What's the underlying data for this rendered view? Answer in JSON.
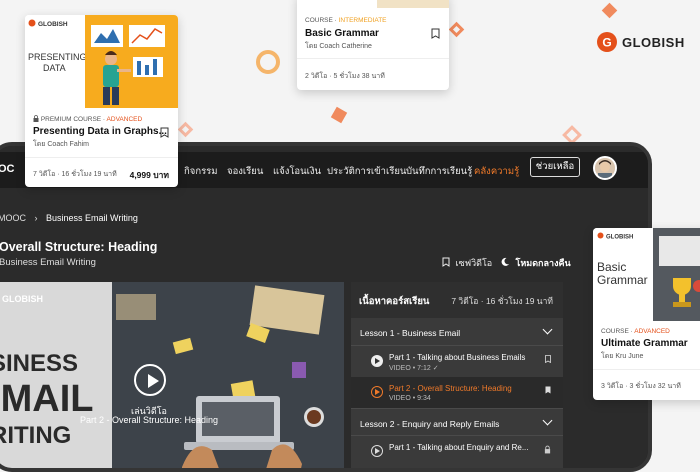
{
  "logo": {
    "text": "GLOBISH"
  },
  "nav": {
    "brand": "OC",
    "items": [
      "กิจกรรม",
      "จองเรียน",
      "แจ้งโอนเงิน",
      "ประวัติการเข้าเรียน",
      "บันทึกการเรียนรู้",
      "คลังความรู้"
    ],
    "help": "ช่วยเหลือ"
  },
  "breadcrumb": {
    "root": "MOOC",
    "current": "Business Email Writing"
  },
  "lesson": {
    "title": "Overall Structure: Heading",
    "course": "Business Email Writing",
    "save_video": "เซฟวิดีโอ",
    "dark_mode": "โหมดกลางคืน"
  },
  "video": {
    "brand": "GLOBISH",
    "cover_lines": [
      "SINESS",
      "-MAIL",
      "RITING"
    ],
    "play_label": "เล่นวิดีโอ",
    "caption": "Part 2 - Overall Structure: Heading"
  },
  "playlist": {
    "title": "เนื้อหาคอร์สเรียน",
    "meta": "7 วิดีโอ · 16 ชั่วโมง 19 นาที",
    "lesson1": "Lesson 1 - Business Email",
    "items": [
      {
        "title": "Part 1 - Talking about Business Emails",
        "meta": "VIDEO • 7:12 ✓"
      },
      {
        "title": "Part 2 - Overall Structure: Heading",
        "meta": "VIDEO • 9:34"
      }
    ],
    "lesson2": "Lesson 2 - Enquiry and Reply Emails",
    "item3": {
      "title": "Part 1 - Talking about Enquiry and Re..."
    }
  },
  "cards": {
    "presenting": {
      "image_text": [
        "PRESENTING",
        "DATA"
      ],
      "badge": "PREMIUM COURSE · ",
      "level": "ADVANCED",
      "title": "Presenting Data in Graphs...",
      "by": "โดย",
      "coach": "Coach Fahim",
      "meta": "7 วิดีโอ · 16 ชั่วโมง 19 นาที",
      "price": "4,999 บาท"
    },
    "basic": {
      "badge": "COURSE · ",
      "level": "INTERMEDIATE",
      "title": "Basic Grammar",
      "by": "โดย",
      "coach": "Coach Catherine",
      "meta": "2 วิดีโอ · 5 ชั่วโมง 38 นาที"
    },
    "ultimate": {
      "brand": "GLOBISH",
      "image_text": [
        "Basic",
        "Grammar"
      ],
      "badge": "COURSE · ",
      "level": "ADVANCED",
      "title": "Ultimate Grammar",
      "by": "โดย",
      "coach": "Kru June",
      "meta": "3 วิดีโอ · 3 ชั่วโมง 32 นาที"
    }
  },
  "colors": {
    "accent": "#f07a2a",
    "brand_red": "#e4501a",
    "dark_bg": "#2b2b2b"
  }
}
